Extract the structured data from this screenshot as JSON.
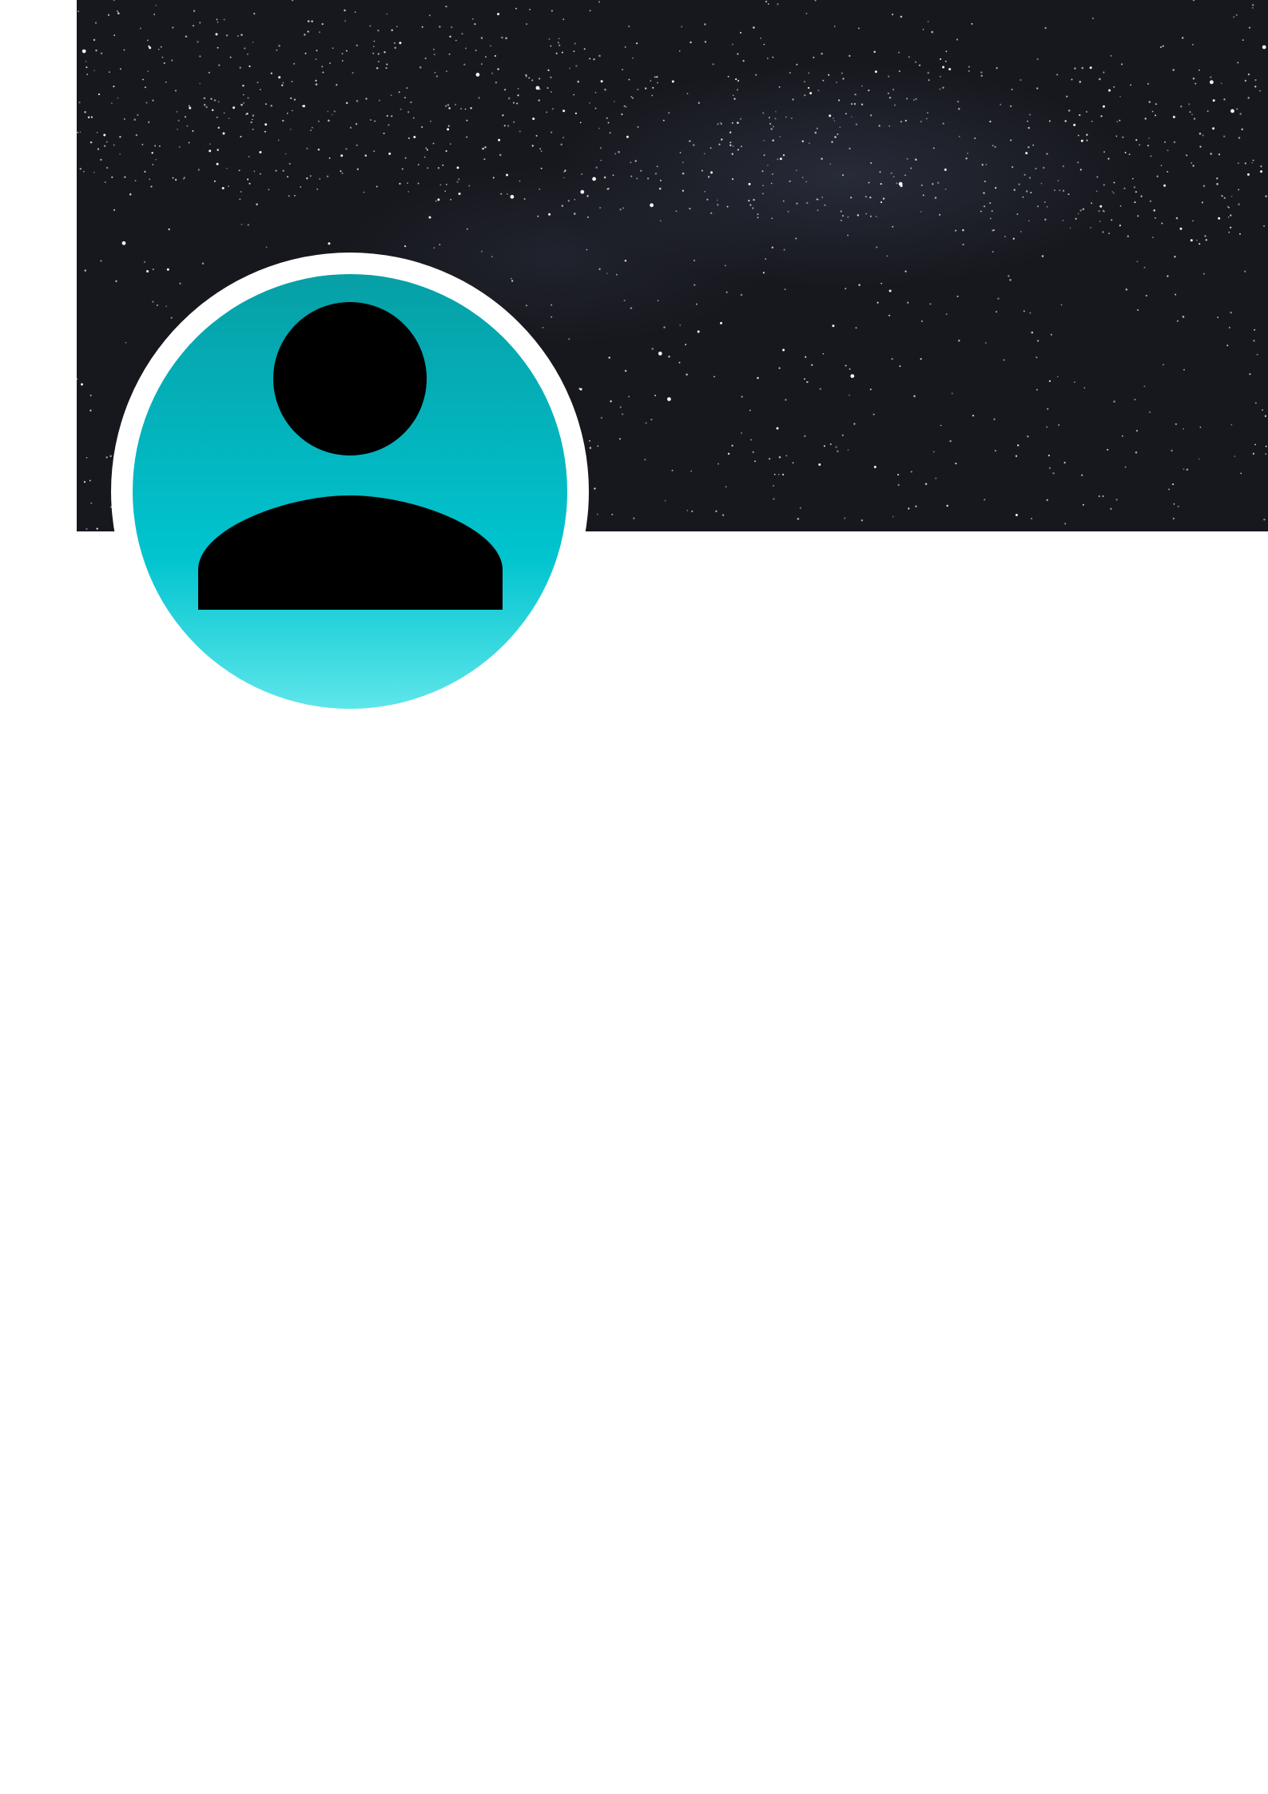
{
  "profile": {
    "cover_image": "starry-night-sky",
    "avatar_icon": "person-icon",
    "avatar_colors": {
      "gradient_top": "#079fa6",
      "gradient_mid": "#00c4cf",
      "gradient_bottom": "#5ee6ea",
      "figure": "#000000",
      "ring": "#ffffff"
    },
    "cover_color": "#17181e"
  }
}
